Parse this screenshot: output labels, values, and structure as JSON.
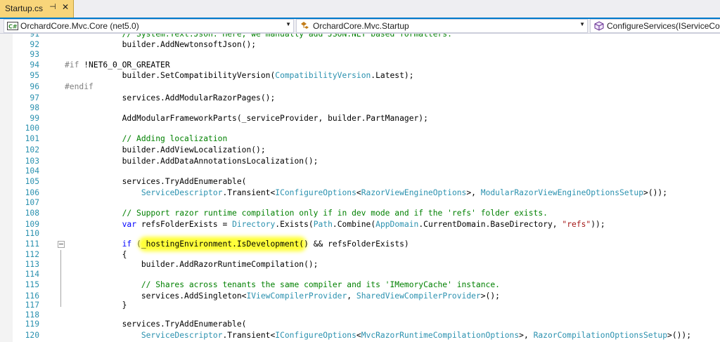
{
  "tab": {
    "title": "Startup.cs",
    "pin_icon": "pin-icon",
    "close_icon": "close-icon"
  },
  "navbar": {
    "project": "OrchardCore.Mvc.Core (net5.0)",
    "type": "OrchardCore.Mvc.Startup",
    "member": "ConfigureServices(IServiceColle"
  },
  "colors": {
    "accent": "#007acc",
    "tab_active": "#f8d57a",
    "highlight": "#ffff3a",
    "line_number": "#2b91af",
    "keyword": "#0000ff",
    "type": "#2b91af",
    "comment": "#008000",
    "string": "#a31515"
  },
  "code_lines": [
    {
      "n": "91",
      "text": "            // System.Text.Json. Here, we manually add JSON.NET based formatters."
    },
    {
      "n": "92",
      "text": "            builder.AddNewtonsoftJson();"
    },
    {
      "n": "93",
      "text": ""
    },
    {
      "n": "94",
      "text": "#if !NET6_0_OR_GREATER"
    },
    {
      "n": "95",
      "text": "            builder.SetCompatibilityVersion(CompatibilityVersion.Latest);"
    },
    {
      "n": "96",
      "text": "#endif"
    },
    {
      "n": "97",
      "text": "            services.AddModularRazorPages();"
    },
    {
      "n": "98",
      "text": ""
    },
    {
      "n": "99",
      "text": "            AddModularFrameworkParts(_serviceProvider, builder.PartManager);"
    },
    {
      "n": "100",
      "text": ""
    },
    {
      "n": "101",
      "text": "            // Adding localization"
    },
    {
      "n": "102",
      "text": "            builder.AddViewLocalization();"
    },
    {
      "n": "103",
      "text": "            builder.AddDataAnnotationsLocalization();"
    },
    {
      "n": "104",
      "text": ""
    },
    {
      "n": "105",
      "text": "            services.TryAddEnumerable("
    },
    {
      "n": "106",
      "text": "                ServiceDescriptor.Transient<IConfigureOptions<RazorViewEngineOptions>, ModularRazorViewEngineOptionsSetup>());"
    },
    {
      "n": "107",
      "text": ""
    },
    {
      "n": "108",
      "text": "            // Support razor runtime compilation only if in dev mode and if the 'refs' folder exists."
    },
    {
      "n": "109",
      "text": "            var refsFolderExists = Directory.Exists(Path.Combine(AppDomain.CurrentDomain.BaseDirectory, \"refs\"));"
    },
    {
      "n": "110",
      "text": ""
    },
    {
      "n": "111",
      "text": "            if (_hostingEnvironment.IsDevelopment() && refsFolderExists)"
    },
    {
      "n": "112",
      "text": "            {"
    },
    {
      "n": "113",
      "text": "                builder.AddRazorRuntimeCompilation();"
    },
    {
      "n": "114",
      "text": ""
    },
    {
      "n": "115",
      "text": "                // Shares across tenants the same compiler and its 'IMemoryCache' instance."
    },
    {
      "n": "116",
      "text": "                services.AddSingleton<IViewCompilerProvider, SharedViewCompilerProvider>();"
    },
    {
      "n": "117",
      "text": "            }"
    },
    {
      "n": "118",
      "text": ""
    },
    {
      "n": "119",
      "text": "            services.TryAddEnumerable("
    },
    {
      "n": "120",
      "text": "                ServiceDescriptor.Transient<IConfigureOptions<MvcRazorRuntimeCompilationOptions>, RazorCompilationOptionsSetup>());"
    }
  ]
}
